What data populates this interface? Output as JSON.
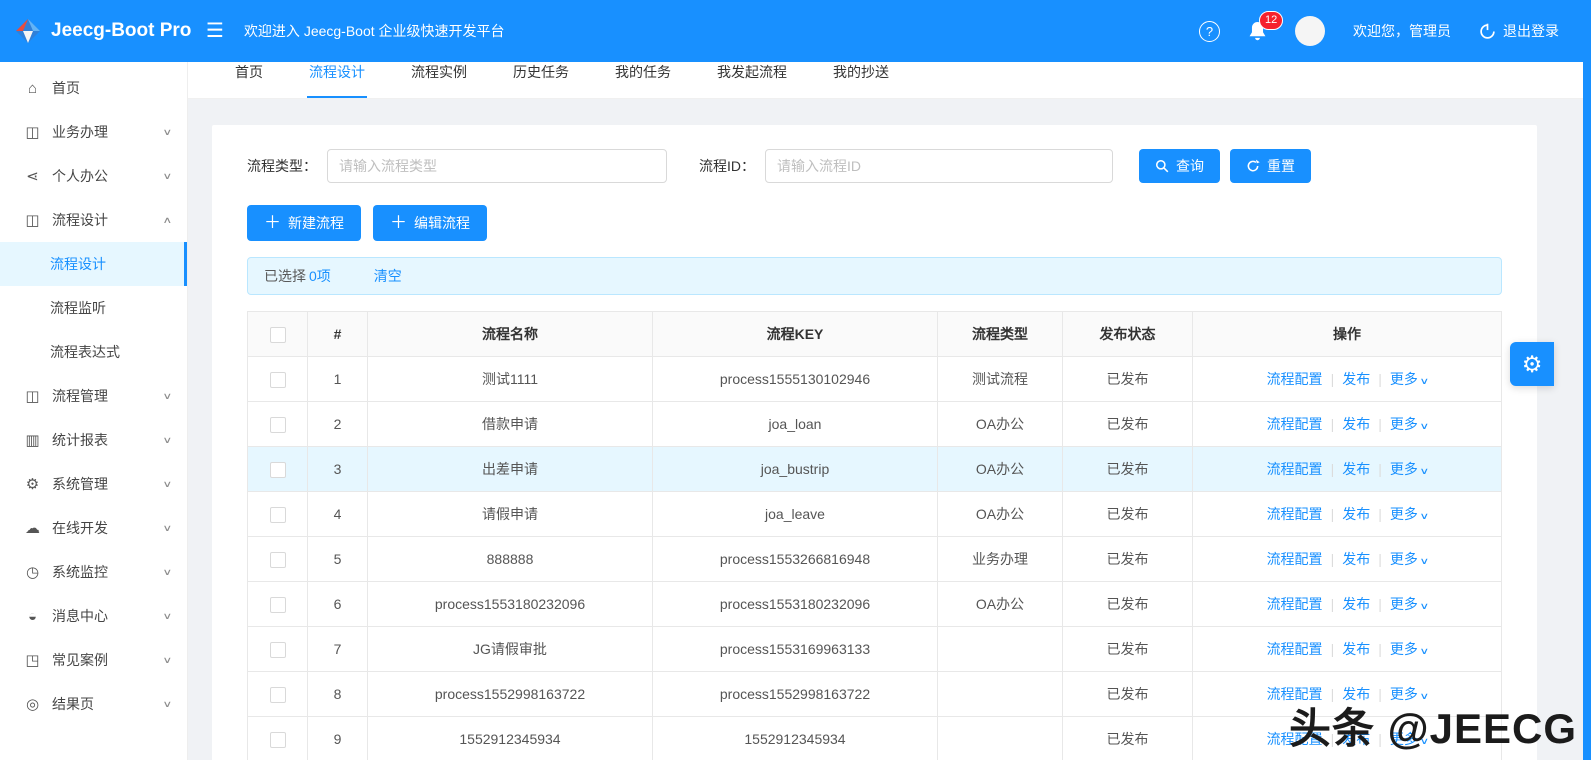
{
  "header": {
    "logo_text": "Jeecg-Boot Pro",
    "welcome": "欢迎进入 Jeecg-Boot 企业级快速开发平台",
    "help": "?",
    "badge_count": "12",
    "greeting": "欢迎您，管理员",
    "logout_label": "退出登录"
  },
  "sidebar": {
    "items": [
      {
        "label": "首页",
        "icon": "home",
        "chevron": ""
      },
      {
        "label": "业务办理",
        "icon": "grid",
        "chevron": "down"
      },
      {
        "label": "个人办公",
        "icon": "share",
        "chevron": "down"
      },
      {
        "label": "流程设计",
        "icon": "cluster",
        "chevron": "up",
        "open": true
      },
      {
        "label": "流程管理",
        "icon": "cluster",
        "chevron": "down"
      },
      {
        "label": "统计报表",
        "icon": "bar-chart",
        "chevron": "down"
      },
      {
        "label": "系统管理",
        "icon": "gear",
        "chevron": "down"
      },
      {
        "label": "在线开发",
        "icon": "cloud",
        "chevron": "down"
      },
      {
        "label": "系统监控",
        "icon": "monitor",
        "chevron": "down"
      },
      {
        "label": "消息中心",
        "icon": "message",
        "chevron": "down"
      },
      {
        "label": "常见案例",
        "icon": "case",
        "chevron": "down"
      },
      {
        "label": "结果页",
        "icon": "result",
        "chevron": "down"
      }
    ],
    "submenu": [
      {
        "label": "流程设计",
        "active": true
      },
      {
        "label": "流程监听",
        "active": false
      },
      {
        "label": "流程表达式",
        "active": false
      }
    ]
  },
  "tabs": [
    {
      "label": "首页",
      "active": false
    },
    {
      "label": "流程设计",
      "active": true
    },
    {
      "label": "流程实例",
      "active": false
    },
    {
      "label": "历史任务",
      "active": false
    },
    {
      "label": "我的任务",
      "active": false
    },
    {
      "label": "我发起流程",
      "active": false
    },
    {
      "label": "我的抄送",
      "active": false
    }
  ],
  "filters": {
    "type_label": "流程类型：",
    "type_placeholder": "请输入流程类型",
    "type_value": "",
    "id_label": "流程ID：",
    "id_placeholder": "请输入流程ID",
    "id_value": "",
    "search_label": "查询",
    "reset_label": "重置"
  },
  "toolbar": {
    "new_label": "新建流程",
    "edit_label": "编辑流程"
  },
  "selection": {
    "prefix": "已选择",
    "count": "0项",
    "clear_label": "清空"
  },
  "table": {
    "headers": [
      "#",
      "流程名称",
      "流程KEY",
      "流程类型",
      "发布状态",
      "操作"
    ],
    "actions": [
      "流程配置",
      "发布",
      "更多"
    ],
    "rows": [
      {
        "num": "1",
        "name": "测试1111",
        "key": "process1555130102946",
        "type": "测试流程",
        "status": "已发布",
        "highlight": false
      },
      {
        "num": "2",
        "name": "借款申请",
        "key": "joa_loan",
        "type": "OA办公",
        "status": "已发布",
        "highlight": false
      },
      {
        "num": "3",
        "name": "出差申请",
        "key": "joa_bustrip",
        "type": "OA办公",
        "status": "已发布",
        "highlight": true
      },
      {
        "num": "4",
        "name": "请假申请",
        "key": "joa_leave",
        "type": "OA办公",
        "status": "已发布",
        "highlight": false
      },
      {
        "num": "5",
        "name": "888888",
        "key": "process1553266816948",
        "type": "业务办理",
        "status": "已发布",
        "highlight": false
      },
      {
        "num": "6",
        "name": "process1553180232096",
        "key": "process1553180232096",
        "type": "OA办公",
        "status": "已发布",
        "highlight": false
      },
      {
        "num": "7",
        "name": "JG请假审批",
        "key": "process1553169963133",
        "type": "",
        "status": "已发布",
        "highlight": false
      },
      {
        "num": "8",
        "name": "process1552998163722",
        "key": "process1552998163722",
        "type": "",
        "status": "已发布",
        "highlight": false
      },
      {
        "num": "9",
        "name": "1552912345934",
        "key": "1552912345934",
        "type": "",
        "status": "已发布",
        "highlight": false
      }
    ]
  },
  "watermark": "头条 @JEECG",
  "colors": {
    "primary": "#1890ff",
    "badge": "#f5222d",
    "row_highlight": "#e6f7ff",
    "alert_bg": "#e6f7ff"
  }
}
